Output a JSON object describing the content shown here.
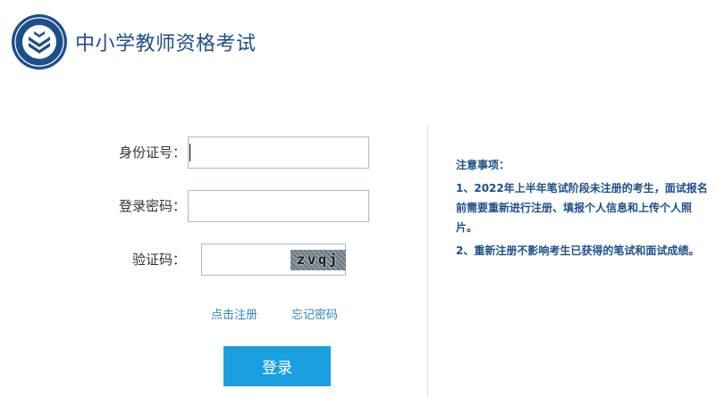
{
  "header": {
    "title": "中小学教师资格考试",
    "logo_icon": "exam-emblem-icon"
  },
  "form": {
    "id_label": "身份证号：",
    "id_value": "",
    "password_label": "登录密码：",
    "password_value": "",
    "captcha_label": "验证码：",
    "captcha_value": "",
    "captcha_text": "zvqj",
    "register_link": "点击注册",
    "forgot_link": "忘记密码",
    "login_button": "登录"
  },
  "notice": {
    "title": "注意事项：",
    "items": [
      "1、2022年上半年笔试阶段未注册的考生，面试报名前需要重新进行注册、填报个人信息和上传个人照片。",
      "2、重新注册不影响考生已获得的笔试和面试成绩。"
    ]
  },
  "colors": {
    "brand": "#1d4f8b",
    "button": "#1aa0e0",
    "link": "#2e86c8"
  }
}
